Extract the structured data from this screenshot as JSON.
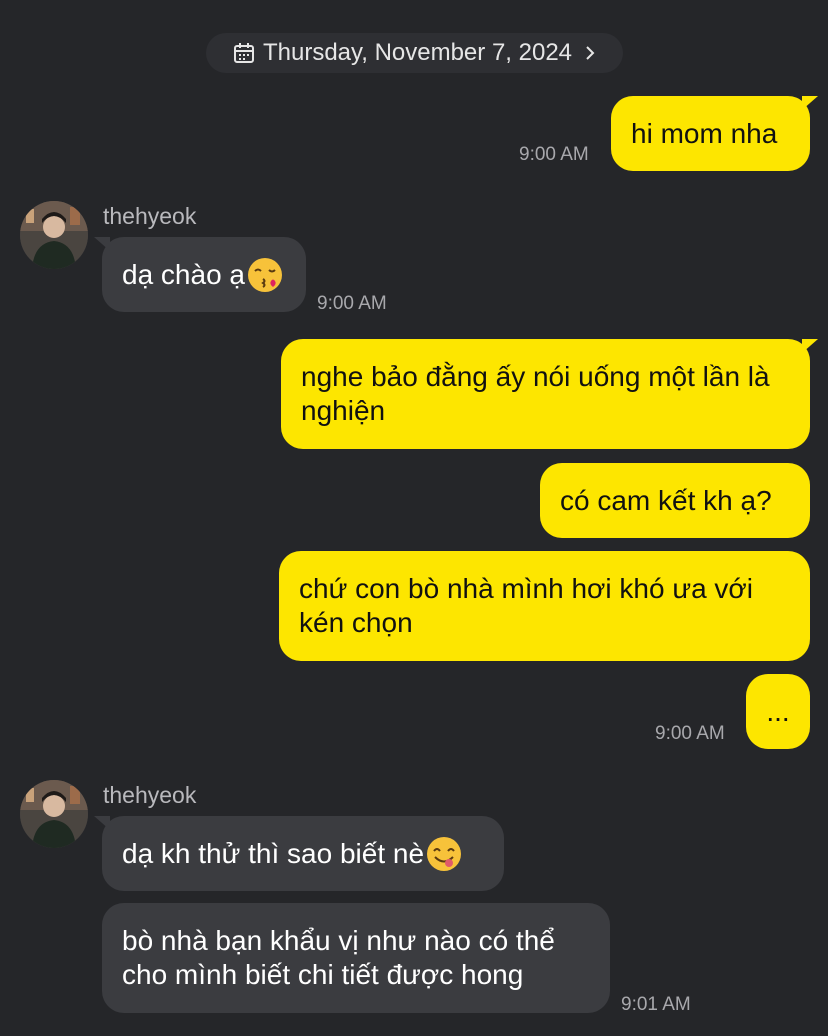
{
  "header": {
    "date": "Thursday, November 7, 2024",
    "calendar_icon": "calendar-icon",
    "chevron_icon": "chevron-right-icon"
  },
  "colors": {
    "background": "#252629",
    "outgoing_bubble": "#fde600",
    "incoming_bubble": "#3b3c40",
    "timestamp": "#a8a8ac"
  },
  "messages": [
    {
      "direction": "out",
      "text": "hi mom nha",
      "time": "9:00 AM"
    },
    {
      "direction": "in",
      "sender": "thehyeok",
      "text": "dạ chào ạ",
      "emoji": "kissing-face-emoji",
      "time": "9:00 AM"
    },
    {
      "direction": "out",
      "text": "nghe bảo đằng ấy nói uống một lần là nghiện"
    },
    {
      "direction": "out",
      "text": "có cam kết kh ạ?"
    },
    {
      "direction": "out",
      "text": "chứ con bò nhà mình hơi khó ưa với kén chọn"
    },
    {
      "direction": "out",
      "text": "...",
      "time": "9:00 AM"
    },
    {
      "direction": "in",
      "sender": "thehyeok",
      "text": "dạ kh thử thì sao biết nè",
      "emoji": "yum-face-emoji"
    },
    {
      "direction": "in",
      "text": "bò nhà bạn khẩu vị như nào có thể cho mình biết chi tiết được hong",
      "time": "9:01 AM"
    }
  ]
}
